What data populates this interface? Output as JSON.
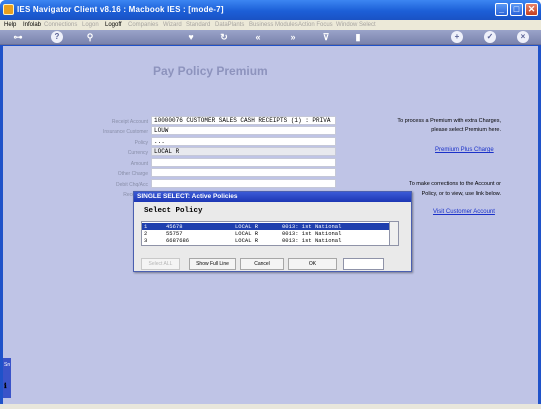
{
  "window": {
    "title": "IES Navigator Client v8.16 : Macbook IES :     [mode-7]",
    "buttons": {
      "minimize": "_",
      "maximize": "□",
      "close": "✕"
    }
  },
  "menubar": {
    "items": [
      {
        "label": "Help",
        "enabled": true
      },
      {
        "label": "Infolab",
        "enabled": true
      },
      {
        "label": "Connections",
        "enabled": false
      },
      {
        "label": "Logon",
        "enabled": false
      },
      {
        "label": "Logoff",
        "enabled": true
      },
      {
        "label": "Companies",
        "enabled": false
      },
      {
        "label": "Wizard",
        "enabled": false
      },
      {
        "label": "Standard",
        "enabled": false
      },
      {
        "label": "DataPlants",
        "enabled": false
      },
      {
        "label": "Business Modules",
        "enabled": false
      },
      {
        "label": "Action Focus",
        "enabled": false
      },
      {
        "label": "Window Select",
        "enabled": false
      }
    ]
  },
  "toolbar": {
    "icons": [
      "key-icon",
      "help-icon",
      "search-icon",
      "heart-icon",
      "refresh-icon",
      "rewind-icon",
      "fast-forward-icon",
      "filter-icon",
      "document-icon",
      "add-icon",
      "check-icon",
      "close-icon"
    ]
  },
  "page": {
    "title": "Pay Policy Premium",
    "fields": [
      {
        "label": "Receipt Account",
        "value": "10000076 CUSTOMER SALES CASH RECEIPTS (1) : PRIVA"
      },
      {
        "label": "Insurance Customer",
        "value": "LOUW"
      },
      {
        "label": "Policy",
        "value": "..."
      },
      {
        "label": "Currency",
        "value": "LOCAL R"
      },
      {
        "label": "Amount",
        "value": ""
      },
      {
        "label": "Other Charge",
        "value": ""
      },
      {
        "label": "Debit Chq/Acc",
        "value": ""
      },
      {
        "label": "Receipt No",
        "value": ""
      },
      {
        "label": "Ref",
        "value": ""
      }
    ],
    "right_panel": {
      "premium_line1": "To process a Premium with extra Charges,",
      "premium_line2": "please select Premium here.",
      "premium_link": "Premium Plus Charge",
      "customer_line1": "To make corrections to the Account or",
      "customer_line2": "Policy, or to view, use link below.",
      "customer_link": "Visit Customer Account"
    }
  },
  "dialog": {
    "title": "SINGLE SELECT: Active Policies",
    "heading": "Select Policy",
    "rows": [
      {
        "num": "1",
        "policy": "45678",
        "currency": "LOCAL R",
        "bank": "0013: 1st National",
        "selected": true
      },
      {
        "num": "2",
        "policy": "55757",
        "currency": "LOCAL R",
        "bank": "0013: 1st National",
        "selected": false
      },
      {
        "num": "3",
        "policy": "6687686",
        "currency": "LOCAL R",
        "bank": "0013: 1st National",
        "selected": false
      }
    ],
    "buttons": {
      "select_all": "Select ALL",
      "show_full_line": "Show Full Line",
      "cancel": "Cancel",
      "ok": "OK"
    }
  },
  "colors": {
    "titlebar": "#1c5fd7",
    "workspace": "#bfc4e6",
    "link": "#1a31c9",
    "selection": "#1f3fae"
  }
}
